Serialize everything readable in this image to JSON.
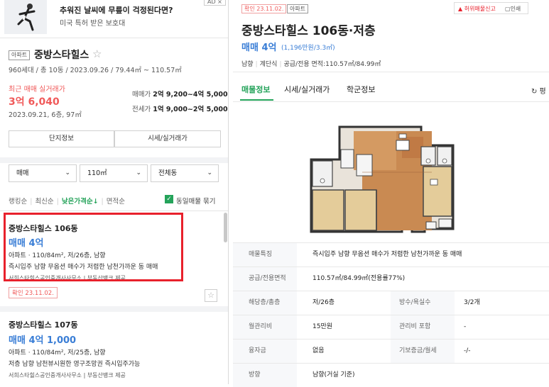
{
  "ad": {
    "title": "추워진 날씨에 무릎이 걱정된다면?",
    "subtitle": "미국 특허 받은 보호대",
    "badge": "AD ×"
  },
  "complex": {
    "type_tag": "아파트",
    "name": "중방스타힐스",
    "info": "960세대 / 총 10동 / 2023.09.26 / 79.44㎡ ~ 110.57㎡",
    "recent_label": "최근 매매 실거래가",
    "recent_price": "3억 6,040",
    "recent_detail": "2023.09.21, 6층, 97㎡",
    "sale_label": "매매가",
    "sale_range": "2억 9,200~4억 5,000",
    "jeonse_label": "전세가",
    "jeonse_range": "1억 9,000~2억 5,000",
    "btn_info": "단지정보",
    "btn_price": "시세/실거래가"
  },
  "filters": {
    "deal": "매매",
    "area": "110㎡",
    "dong": "전체동"
  },
  "sort": {
    "ranking": "랭킹순",
    "latest": "최신순",
    "low_price": "낮은가격순↓",
    "area": "면적순",
    "group_label": "동일매물 묶기"
  },
  "listings": [
    {
      "name": "중방스타힐스 106동",
      "price": "매매 4억",
      "spec": "아파트 · 110/84m², 저/26층, 남향",
      "desc": "즉시입주 남향 무옵션 매수가 저렴한 남천가까운 동 매매",
      "agent": "서희스타힐스공인중개사사무소 | 부동산뱅크 제공",
      "badge": "확인 23.11.02."
    },
    {
      "name": "중방스타힐스 107동",
      "price": "매매 4억 1,000",
      "spec": "아파트 · 110/84m², 저/25층, 남향",
      "desc": "저층 남향 남천뷰시원한 영구조망권 즉시입주가능",
      "agent": "서희스타힐스공인중개사사무소 | 부동산뱅크 제공"
    }
  ],
  "detail": {
    "badge_confirm": "확인 23.11.02.",
    "badge_type": "아파트",
    "report": "허위매물신고",
    "print": "인쇄",
    "title": "중방스타힐스 106동·저층",
    "price": "매매 4억",
    "price_sub": "(1,196만원/3.3㎡)",
    "meta": [
      "남향",
      "계단식",
      "공급/전용 면적:110.57㎡/84.99㎡"
    ],
    "tabs": [
      "매물정보",
      "시세/실거래가",
      "학군정보"
    ],
    "refresh": "↻ 평",
    "rows": [
      {
        "label": "매물특징",
        "value": "즉시입주 남향 무옵션 매수가 저렴한 남천가까운 동 매매"
      },
      {
        "label": "공급/전용면적",
        "value": "110.57㎡/84.99㎡(전용률77%)"
      },
      {
        "label": "해당층/총층",
        "value": "저/26층",
        "label2": "방수/욕실수",
        "value2": "3/2개"
      },
      {
        "label": "월관리비",
        "value": "15만원",
        "label2": "관리비 포함",
        "value2": "-"
      },
      {
        "label": "융자금",
        "value": "없음",
        "label2": "기보증금/월세",
        "value2": "-/-"
      },
      {
        "label": "방향",
        "value": "남향(거실 기준)"
      }
    ]
  },
  "colors": {
    "accent_green": "#24a35a",
    "price_blue": "#3a7ed6",
    "highlight_red": "#e8212c",
    "recent_red": "#f05a5a"
  }
}
